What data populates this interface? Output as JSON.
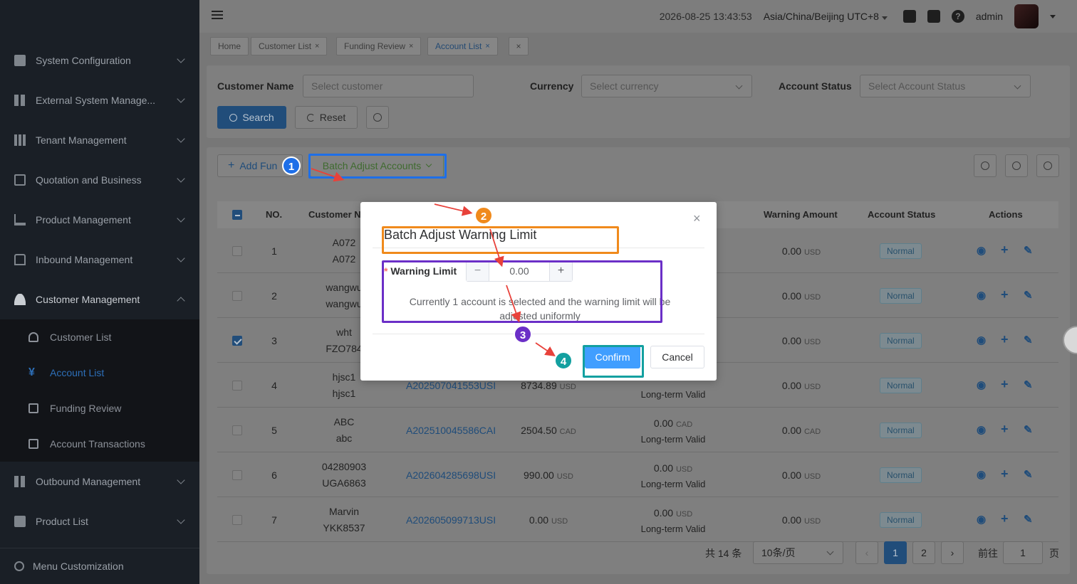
{
  "sidebar": {
    "items": [
      {
        "label": "System Configuration"
      },
      {
        "label": "External System Manage..."
      },
      {
        "label": "Tenant Management"
      },
      {
        "label": "Quotation and Business"
      },
      {
        "label": "Product Management"
      },
      {
        "label": "Inbound Management"
      },
      {
        "label": "Customer Management"
      },
      {
        "label": "Outbound Management"
      },
      {
        "label": "Product List"
      }
    ],
    "submenu": [
      {
        "label": "Customer List"
      },
      {
        "label": "Account List"
      },
      {
        "label": "Funding Review"
      },
      {
        "label": "Account Transactions"
      }
    ],
    "footer": "Menu Customization"
  },
  "header": {
    "datetime": "2026-08-25 13:43:53",
    "timezone": "Asia/China/Beijing UTC+8",
    "user": "admin"
  },
  "tabs": [
    {
      "label": "Home"
    },
    {
      "label": "Customer List"
    },
    {
      "label": "Funding Review"
    },
    {
      "label": "Account List"
    }
  ],
  "filters": {
    "customer_label": "Customer Name",
    "customer_placeholder": "Select customer",
    "currency_label": "Currency",
    "currency_placeholder": "Select currency",
    "status_label": "Account Status",
    "status_placeholder": "Select Account Status",
    "search": "Search",
    "reset": "Reset"
  },
  "toolbar": {
    "add": "Add Fun",
    "batch": "Batch Adjust Accounts"
  },
  "table": {
    "headers": {
      "no": "NO.",
      "customer": "Customer N",
      "warning": "Warning Amount",
      "status": "Account Status",
      "actions": "Actions"
    },
    "rows": [
      {
        "no": "1",
        "c1": "A072",
        "c2": "A072",
        "acct": "",
        "bal": "",
        "bal_cur": "",
        "lim": "",
        "lim_cur": "",
        "valid": "",
        "warn": "0.00",
        "warn_cur": "USD",
        "status": "Normal",
        "checked": false
      },
      {
        "no": "2",
        "c1": "wangwu",
        "c2": "wangwu",
        "acct": "",
        "bal": "",
        "bal_cur": "",
        "lim": "",
        "lim_cur": "",
        "valid": "",
        "warn": "0.00",
        "warn_cur": "USD",
        "status": "Normal",
        "checked": false
      },
      {
        "no": "3",
        "c1": "wht",
        "c2": "FZO784",
        "acct": "",
        "bal": "",
        "bal_cur": "",
        "lim": "",
        "lim_cur": "",
        "valid": "",
        "warn": "0.00",
        "warn_cur": "USD",
        "status": "Normal",
        "checked": true
      },
      {
        "no": "4",
        "c1": "hjsc1",
        "c2": "hjsc1",
        "acct": "A202507041553USI",
        "bal": "8734.89",
        "bal_cur": "USD",
        "lim": "",
        "lim_cur": "",
        "valid": "Long-term Valid",
        "warn": "0.00",
        "warn_cur": "USD",
        "status": "Normal",
        "checked": false
      },
      {
        "no": "5",
        "c1": "ABC",
        "c2": "abc",
        "acct": "A202510045586CAI",
        "bal": "2504.50",
        "bal_cur": "CAD",
        "lim": "0.00",
        "lim_cur": "CAD",
        "valid": "Long-term Valid",
        "warn": "0.00",
        "warn_cur": "CAD",
        "status": "Normal",
        "checked": false
      },
      {
        "no": "6",
        "c1": "04280903",
        "c2": "UGA6863",
        "acct": "A202604285698USI",
        "bal": "990.00",
        "bal_cur": "USD",
        "lim": "0.00",
        "lim_cur": "USD",
        "valid": "Long-term Valid",
        "warn": "0.00",
        "warn_cur": "USD",
        "status": "Normal",
        "checked": false
      },
      {
        "no": "7",
        "c1": "Marvin",
        "c2": "YKK8537",
        "acct": "A202605099713USI",
        "bal": "0.00",
        "bal_cur": "USD",
        "lim": "0.00",
        "lim_cur": "USD",
        "valid": "Long-term Valid",
        "warn": "0.00",
        "warn_cur": "USD",
        "status": "Normal",
        "checked": false
      }
    ]
  },
  "pagination": {
    "total": "共 14 条",
    "page_size": "10条/页",
    "pages": [
      "1",
      "2"
    ],
    "goto_label": "前往",
    "goto_value": "1",
    "goto_suffix": "页"
  },
  "modal": {
    "title": "Batch Adjust Warning Limit",
    "field_label": "Warning Limit",
    "value": "0.00",
    "hint": "Currently 1 account is selected and the warning limit will be adjusted uniformly",
    "confirm": "Confirm",
    "cancel": "Cancel"
  },
  "annotations": {
    "badges": [
      "1",
      "2",
      "3",
      "4"
    ],
    "colors": {
      "blue": "#1e6fe8",
      "orange": "#f08a1c",
      "purple": "#6b2fc7",
      "teal": "#13a0a0",
      "arrow": "#e8413a"
    }
  }
}
